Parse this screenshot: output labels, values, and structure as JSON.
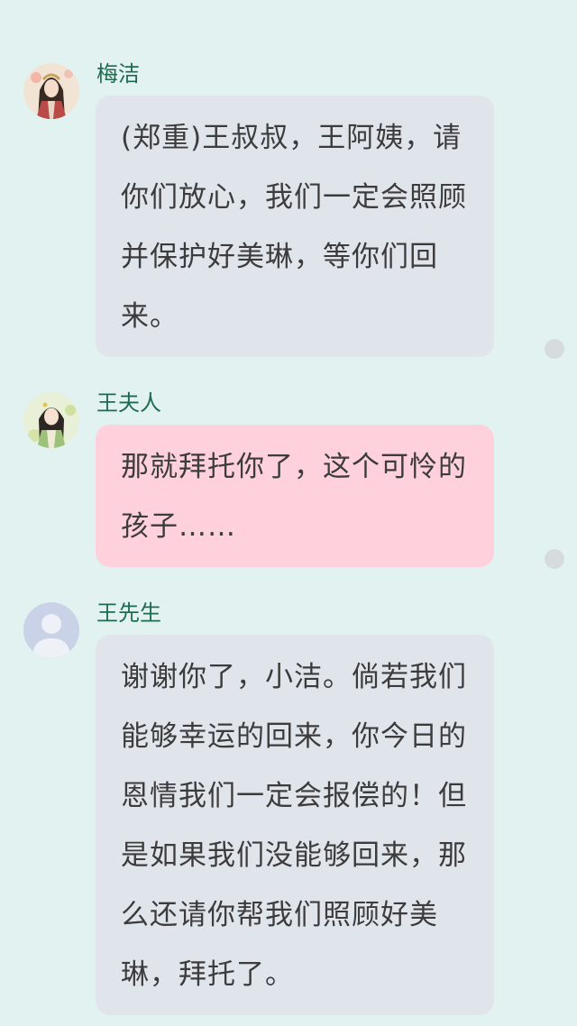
{
  "messages": [
    {
      "sender": "梅洁",
      "avatar_icon": "woman-portrait-avatar-icon",
      "text": "(郑重)王叔叔，王阿姨，请你们放心，我们一定会照顾并保护好美琳，等你们回来。",
      "bubble_color": "#e0e5ec"
    },
    {
      "sender": "王夫人",
      "avatar_icon": "lady-portrait-avatar-icon",
      "text": "那就拜托你了，这个可怜的孩子……",
      "bubble_color": "#ffd1dc"
    },
    {
      "sender": "王先生",
      "avatar_icon": "default-user-avatar-icon",
      "text": "谢谢你了，小洁。倘若我们能够幸运的回来，你今日的恩情我们一定会报偿的！但是如果我们没能够回来，那么还请你帮我们照顾好美琳，拜托了。",
      "bubble_color": "#e0e5ec"
    }
  ],
  "colors": {
    "background": "#e2f2f1",
    "name_text": "#1f6b4f",
    "bubble_text": "#3c3c3c",
    "status_dot": "#d6dbde"
  }
}
